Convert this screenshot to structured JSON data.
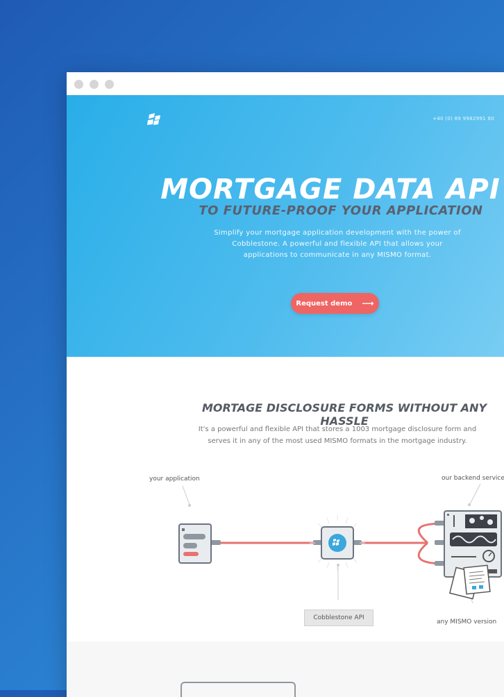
{
  "window_controls": [
    "close",
    "minimize",
    "maximize"
  ],
  "hero": {
    "phone": "+40 (0) 89 9982991 80",
    "title": "MORTGAGE DATA API",
    "subtitle": "TO FUTURE-PROOF YOUR APPLICATION",
    "description": "Simplify your mortgage application development with the power of Cobblestone. A powerful and flexible API that allows  your applications to communicate in any MISMO format.",
    "cta_label": "Request demo",
    "cta_icon": "arrow-right-icon",
    "background_start": "#29aee8",
    "background_end": "#79cdf3",
    "cta_color": "#ee6563"
  },
  "section2": {
    "title": "MORTAGE DISCLOSURE FORMS WITHOUT ANY HASSLE",
    "description": "It's a powerful and flexible API that stores a 1003 mortgage disclosure form and serves it in any of the most used MISMO formats in the mortgage industry.",
    "diagram": {
      "label_app": "your application",
      "label_backend": "our backend service",
      "label_api": "Cobblestone API",
      "label_mismo": "any MISMO version",
      "connector_color": "#e7726f"
    }
  }
}
